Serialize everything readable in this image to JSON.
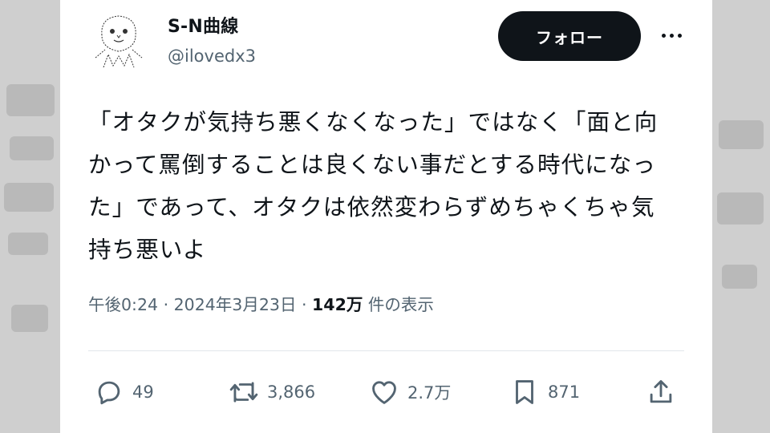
{
  "author": {
    "name": "S-N曲線",
    "handle": "@ilovedx3"
  },
  "follow_label": "フォロー",
  "tweet": {
    "text": "「オタクが気持ち悪くなくなった」ではなく「面と向かって罵倒することは良くない事だとする時代になった」であって、オタクは依然変わらずめちゃくちゃ気持ち悪いよ"
  },
  "meta": {
    "time": "午後0:24",
    "separator": "·",
    "date": "2024年3月23日",
    "views_count": "142万",
    "views_label": "件の表示"
  },
  "actions": {
    "reply_count": "49",
    "retweet_count": "3,866",
    "like_count": "2.7万",
    "bookmark_count": "871"
  },
  "icons": [
    "avatar-drawing",
    "more-icon",
    "reply-icon",
    "retweet-icon",
    "like-icon",
    "bookmark-icon",
    "share-icon"
  ],
  "colors": {
    "text": "#0f1419",
    "secondary": "#536471",
    "button_bg": "#0f1419",
    "button_text": "#ffffff"
  }
}
